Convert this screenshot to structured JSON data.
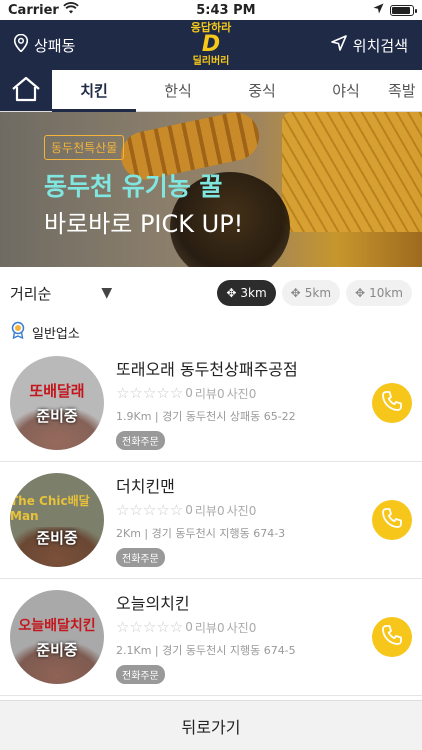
{
  "status": {
    "carrier": "Carrier",
    "time": "5:43 PM"
  },
  "header": {
    "location": "상패동",
    "search": "위치검색",
    "logo_top": "응답하라",
    "logo_mark": "D",
    "logo_bottom": "딜리버리"
  },
  "tabs": [
    {
      "label": "치킨"
    },
    {
      "label": "한식"
    },
    {
      "label": "중식"
    },
    {
      "label": "야식"
    },
    {
      "label": "족발"
    }
  ],
  "banner": {
    "tag": "동두천특산물",
    "title1": "동두천 유기농 꿀",
    "title2": "바로바로 PICK UP!"
  },
  "sort": {
    "label": "거리순"
  },
  "distance": [
    "3km",
    "5km",
    "10km"
  ],
  "category": "일반업소",
  "stores": [
    {
      "name": "또래오래 동두천상패주공점",
      "thumb_name": "또배달래",
      "prep": "준비중",
      "rating": "0",
      "reviews": "리뷰0",
      "photos": "사진0",
      "address": "1.9Km | 경기 동두천시 상패동 65-22",
      "tag": "전화주문"
    },
    {
      "name": "더치킨맨",
      "thumb_name": "The Chic배달Man",
      "prep": "준비중",
      "rating": "0",
      "reviews": "리뷰0",
      "photos": "사진0",
      "address": "2Km | 경기 동두천시 지행동 674-3",
      "tag": "전화주문"
    },
    {
      "name": "오늘의치킨",
      "thumb_name": "오늘배달치킨",
      "prep": "준비중",
      "rating": "0",
      "reviews": "리뷰0",
      "photos": "사진0",
      "address": "2.1Km | 경기 동두천시 지행동 674-5",
      "tag": "전화주문"
    }
  ],
  "bottom": {
    "back": "뒤로가기"
  },
  "colors": {
    "navy": "#1f2a47",
    "yellow": "#f7c61a",
    "teal": "#7fe6e0"
  }
}
